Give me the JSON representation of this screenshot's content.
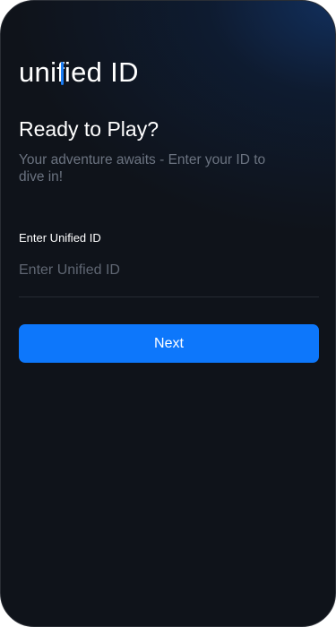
{
  "brand": {
    "logo_word": "uniﬁed",
    "logo_suffix": "ID",
    "accent_color": "#1a7cf2"
  },
  "screen": {
    "title": "Ready to Play?",
    "subtitle": "Your adventure awaits - Enter your ID to dive in!"
  },
  "form": {
    "id_label": "Enter Unified ID",
    "id_placeholder": "Enter Unified ID",
    "id_value": ""
  },
  "actions": {
    "next_label": "Next",
    "primary_color": "#0d77fb"
  }
}
